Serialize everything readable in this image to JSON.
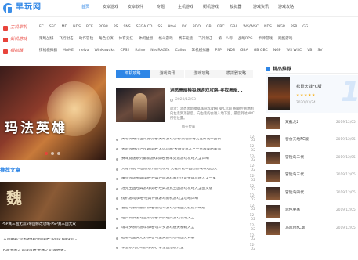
{
  "header": {
    "logo_text": "早玩网",
    "nav": [
      "首页",
      "安卓游戏",
      "安卓软件",
      "专题",
      "主机游戏",
      "街机游戏",
      "模拟器",
      "游戏资讯",
      "游戏攻略"
    ]
  },
  "categories": [
    {
      "label": "主机掌机",
      "items": [
        "FC",
        "SFC",
        "MD",
        "NDS",
        "PCE",
        "PC98",
        "PS",
        "SNS",
        "SEGA CD",
        "SS",
        "Atari",
        "DC",
        "3DO",
        "GB",
        "GBC",
        "GBA",
        "WS/WSC",
        "NDS",
        "NGP",
        "PSP",
        "GG"
      ]
    },
    {
      "label": "街机游戏",
      "items": [
        "策略战棋",
        "飞行射击",
        "动作冒险",
        "角色扮演",
        "体育竞技",
        "休闲益智",
        "格斗游戏",
        "赛车竞速",
        "飞行射击",
        "第一人称",
        "战略RPG",
        "卡牌游戏",
        "跑酷游戏"
      ]
    },
    {
      "label": "模拟器",
      "items": [
        "街机模拟器",
        "MAME",
        "neiva",
        "WinKawaks",
        "CPS2",
        "Raine",
        "NeoRAGEx",
        "Callus",
        "掌机模拟器",
        "PSP",
        "NDS",
        "GBA",
        "GB GBC",
        "NGP",
        "WS WSC",
        "VB",
        "SV"
      ]
    }
  ],
  "banner": {
    "title": "玛法英雄"
  },
  "left_section": {
    "title": "推荐文章",
    "image_big_text": "魏",
    "image_caption": "PSP真三国无双5帝国修改攻略·PSP真三国无双"
  },
  "left_list": [
    "大国崛起·斗者游戏启程攻略·Tomb Raider...",
    "PSP光荣之饥饿攻略·光荣之饥饿通关..."
  ],
  "tabs": [
    "单机攻略",
    "游戏资讯",
    "游戏攻略",
    "模拟器攻略"
  ],
  "featured": {
    "title": "洞悉黑暗模拟器游戏攻略-寻找黑暗...",
    "date": "2020/12/03",
    "desc": "简介：洞悉黑暗模拟器游戏攻略[NPC宫殿]根据左侧地图向左走到顶部后，向右走的会进入地下室，最后到达NPC所在位置。",
    "tail": "所在位置"
  },
  "news": [
    {
      "title": "天地传奇九世传说攻略·天命游戏攻略·天地传奇九世传说一览表",
      "date": "12-02"
    },
    {
      "title": "天地传奇九世传说攻略·无尽攻略·天命传说九世一览表攻略详情",
      "date": "12-02"
    },
    {
      "title": "赛车竞速系列最新游戏攻略·赛车竞速游戏攻略大全详细",
      "date": "12-02"
    },
    {
      "title": "英雄传说·三国志系列游戏攻略·英雄传说三国志游戏攻略图文",
      "date": "12-02"
    },
    {
      "title": "魔界传说英雄攻略·经典怀旧游戏魔界传说英雄攻略大全一览",
      "date": "12-02"
    },
    {
      "title": "洛克王国经典游戏攻略·经典洛克王国游戏攻略大全图文版",
      "date": "12-02"
    },
    {
      "title": "街机游戏攻略·经典怀旧游戏街机游戏全攻略详细",
      "date": "12-02"
    },
    {
      "title": "冒险岛系列最新攻略·冒险岛游戏攻略图文教程详细版",
      "date": "12-02"
    },
    {
      "title": "经典怀旧游戏合集攻略·怀旧经典游戏攻略大全",
      "date": "12-02"
    },
    {
      "title": "魂斗罗系列游戏攻略·魂斗罗游戏通关秘籍大全",
      "date": "12-02"
    },
    {
      "title": "超级马里奥兄弟攻略·马里奥游戏攻略图文详解",
      "date": "12-02"
    },
    {
      "title": "拳皇系列格斗游戏攻略·拳皇出招表大全",
      "date": "12-02"
    }
  ],
  "rank": {
    "title": "精品推荐",
    "top": {
      "name": "松鼠大战FC版",
      "stars": "★★★★★",
      "date": "2020/03/24",
      "num": "1"
    },
    "items": [
      {
        "name": "双截龙2",
        "date": "2019/12/05"
      },
      {
        "name": "吞食天地FC版",
        "date": "2019/12/05"
      },
      {
        "name": "冒险岛二代",
        "date": "2019/12/05"
      },
      {
        "name": "冒险岛三代",
        "date": "2019/12/05"
      },
      {
        "name": "冒险岛四代",
        "date": "2019/12/05"
      },
      {
        "name": "赤色要塞",
        "date": "2019/12/05"
      },
      {
        "name": "马戏团FC版",
        "date": "2019/12/05"
      }
    ]
  }
}
